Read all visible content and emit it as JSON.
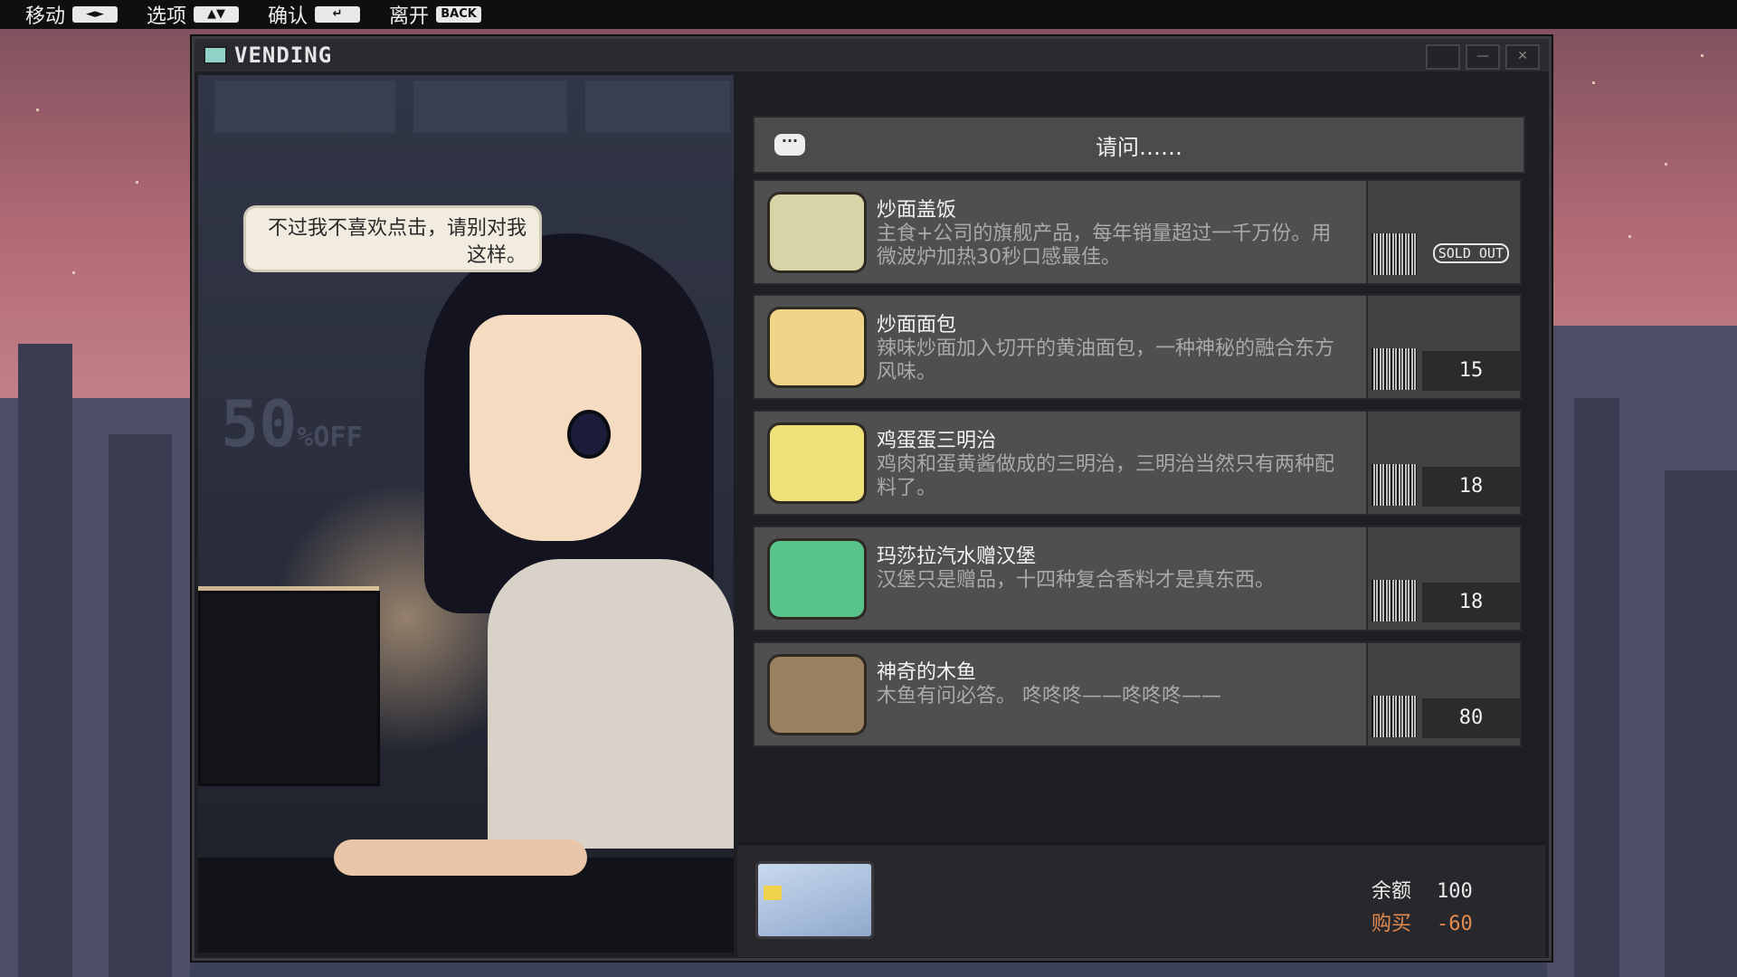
{
  "controls": [
    {
      "label": "移动",
      "key": "◄►"
    },
    {
      "label": "选项",
      "key": "▲▼"
    },
    {
      "label": "确认",
      "key": "↵"
    },
    {
      "label": "离开",
      "key": "BACK"
    }
  ],
  "window": {
    "title": "VENDING"
  },
  "scene": {
    "speech": "不过我不喜欢点击，请别对我这样。",
    "poster": {
      "big": "50",
      "small": "%OFF"
    }
  },
  "prompt": "请问……",
  "items": [
    {
      "name": "炒面盖饭",
      "desc": "主食+公司的旗舰产品，每年销量超过一千万份。用微波炉加热30秒口感最佳。",
      "price": "",
      "status": "SOLD OUT",
      "thumb_color": "#d9d3a8"
    },
    {
      "name": "炒面面包",
      "desc": "辣味炒面加入切开的黄油面包，一种神秘的融合东方风味。",
      "price": "15",
      "status": "",
      "thumb_color": "#f0d589"
    },
    {
      "name": "鸡蛋蛋三明治",
      "desc": "鸡肉和蛋黄酱做成的三明治，三明治当然只有两种配料了。",
      "price": "18",
      "status": "",
      "thumb_color": "#efe07a"
    },
    {
      "name": "玛莎拉汽水赠汉堡",
      "desc": "汉堡只是赠品，十四种复合香料才是真东西。",
      "price": "18",
      "status": "",
      "thumb_color": "#58c38a"
    },
    {
      "name": "神奇的木鱼",
      "desc": "木鱼有问必答。 咚咚咚——咚咚咚——",
      "price": "80",
      "status": "",
      "thumb_color": "#9a8260"
    }
  ],
  "wallet": {
    "balance_label": "余额",
    "balance_value": "100",
    "buy_label": "购买",
    "buy_value": "-60"
  },
  "colors": {
    "accent_buy": "#e38a4e",
    "item_bg": "#4f4f52",
    "window_bg": "#1e1f24"
  }
}
